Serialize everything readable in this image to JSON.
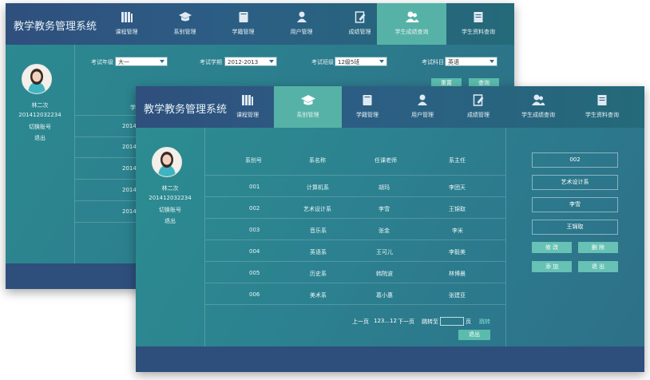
{
  "app_title": "教学教务管理系统",
  "back_window": {
    "nav": [
      {
        "label": "课程管理",
        "icon": "books-icon"
      },
      {
        "label": "系别管理",
        "icon": "graduation-cap-icon"
      },
      {
        "label": "学籍管理",
        "icon": "book-icon"
      },
      {
        "label": "用户管理",
        "icon": "user-icon"
      },
      {
        "label": "成绩管理",
        "icon": "edit-document-icon"
      },
      {
        "label": "学生成绩查询",
        "icon": "users-icon",
        "active": true
      },
      {
        "label": "学生资料查询",
        "icon": "notebook-icon"
      }
    ],
    "user": {
      "name": "林二次",
      "id": "201412032234",
      "switch": "切换账号",
      "logout": "退出"
    },
    "filters": [
      {
        "label": "考试年级",
        "value": "大一"
      },
      {
        "label": "考试学期",
        "value": "2012-2013"
      },
      {
        "label": "考试班级",
        "value": "12级5班"
      },
      {
        "label": "考试科目",
        "value": "英语"
      }
    ],
    "buttons": {
      "reset": "重置",
      "query": "查询"
    },
    "partial_header": "学",
    "partial_rows": [
      "2014",
      "2014",
      "2014",
      "2014",
      "2014"
    ]
  },
  "front_window": {
    "nav": [
      {
        "label": "课程管理",
        "icon": "books-icon"
      },
      {
        "label": "系别管理",
        "icon": "graduation-cap-icon",
        "active": true
      },
      {
        "label": "学籍管理",
        "icon": "book-icon"
      },
      {
        "label": "用户管理",
        "icon": "user-icon"
      },
      {
        "label": "成绩管理",
        "icon": "edit-document-icon"
      },
      {
        "label": "学生成绩查询",
        "icon": "users-icon"
      },
      {
        "label": "学生资料查询",
        "icon": "notebook-icon"
      }
    ],
    "user": {
      "name": "林二次",
      "id": "201412032234",
      "switch": "切换账号",
      "logout": "退出"
    },
    "table": {
      "headers": [
        "系别号",
        "系名称",
        "任课老师",
        "系主任"
      ],
      "rows": [
        [
          "001",
          "计算机系",
          "胡玛",
          "李团天"
        ],
        [
          "002",
          "艺术设计系",
          "李雪",
          "王锦取"
        ],
        [
          "003",
          "音乐系",
          "张金",
          "李米"
        ],
        [
          "004",
          "英语系",
          "王可儿",
          "李毅美"
        ],
        [
          "005",
          "历史系",
          "韩院波",
          "林博晨"
        ],
        [
          "006",
          "美术系",
          "葛小惠",
          "张建亚"
        ]
      ]
    },
    "pager": {
      "prev": "上一页",
      "pages": "123...12",
      "next": "下一页",
      "jump_to": "跳转至",
      "page_unit": "页",
      "go": "跳转",
      "exit": "退出"
    },
    "detail": {
      "fields": [
        "002",
        "艺术设计系",
        "李雪",
        "王锦取"
      ],
      "buttons": {
        "modify": "修 改",
        "delete": "删 除",
        "add": "添 加",
        "exit": "退 出"
      }
    }
  }
}
